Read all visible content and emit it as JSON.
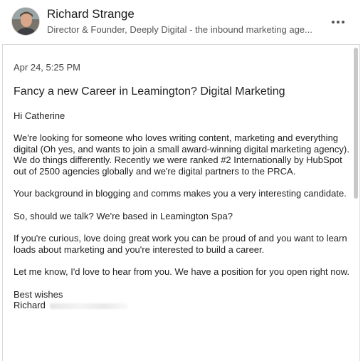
{
  "header": {
    "sender_name": "Richard Strange",
    "sender_headline": "Director & Founder, Deeply Digital - the inbound marketing age...",
    "more_icon": "more-horizontal-icon"
  },
  "message": {
    "timestamp": "Apr 24, 5:25 PM",
    "subject": "Fancy a new Career in Leamington? Digital Marketing",
    "greeting": "Hi Catherine",
    "paragraphs": [
      "We're looking for someone who loves writing content, marketing and everything digital (Oh yes, and wants to join a small award-winning digital marketing agency). We do things differently. Recently we were ranked #2 Internationally by HubSpot out of 2500 agencies globally and we're digital partners to the PRCA.",
      "Your background in blogging and comms makes you a very interesting candidate.",
      "So, should we talk? We're based in Leamington Spa?",
      "If you're curious, love doing great work you can be proud of and you want to learn loads about marketing and you're interested to build a career.",
      "Let me know, I'd love to hear from you. We have a position for you open right now."
    ],
    "signoff": "Best wishes",
    "signature_name": "Richard"
  }
}
